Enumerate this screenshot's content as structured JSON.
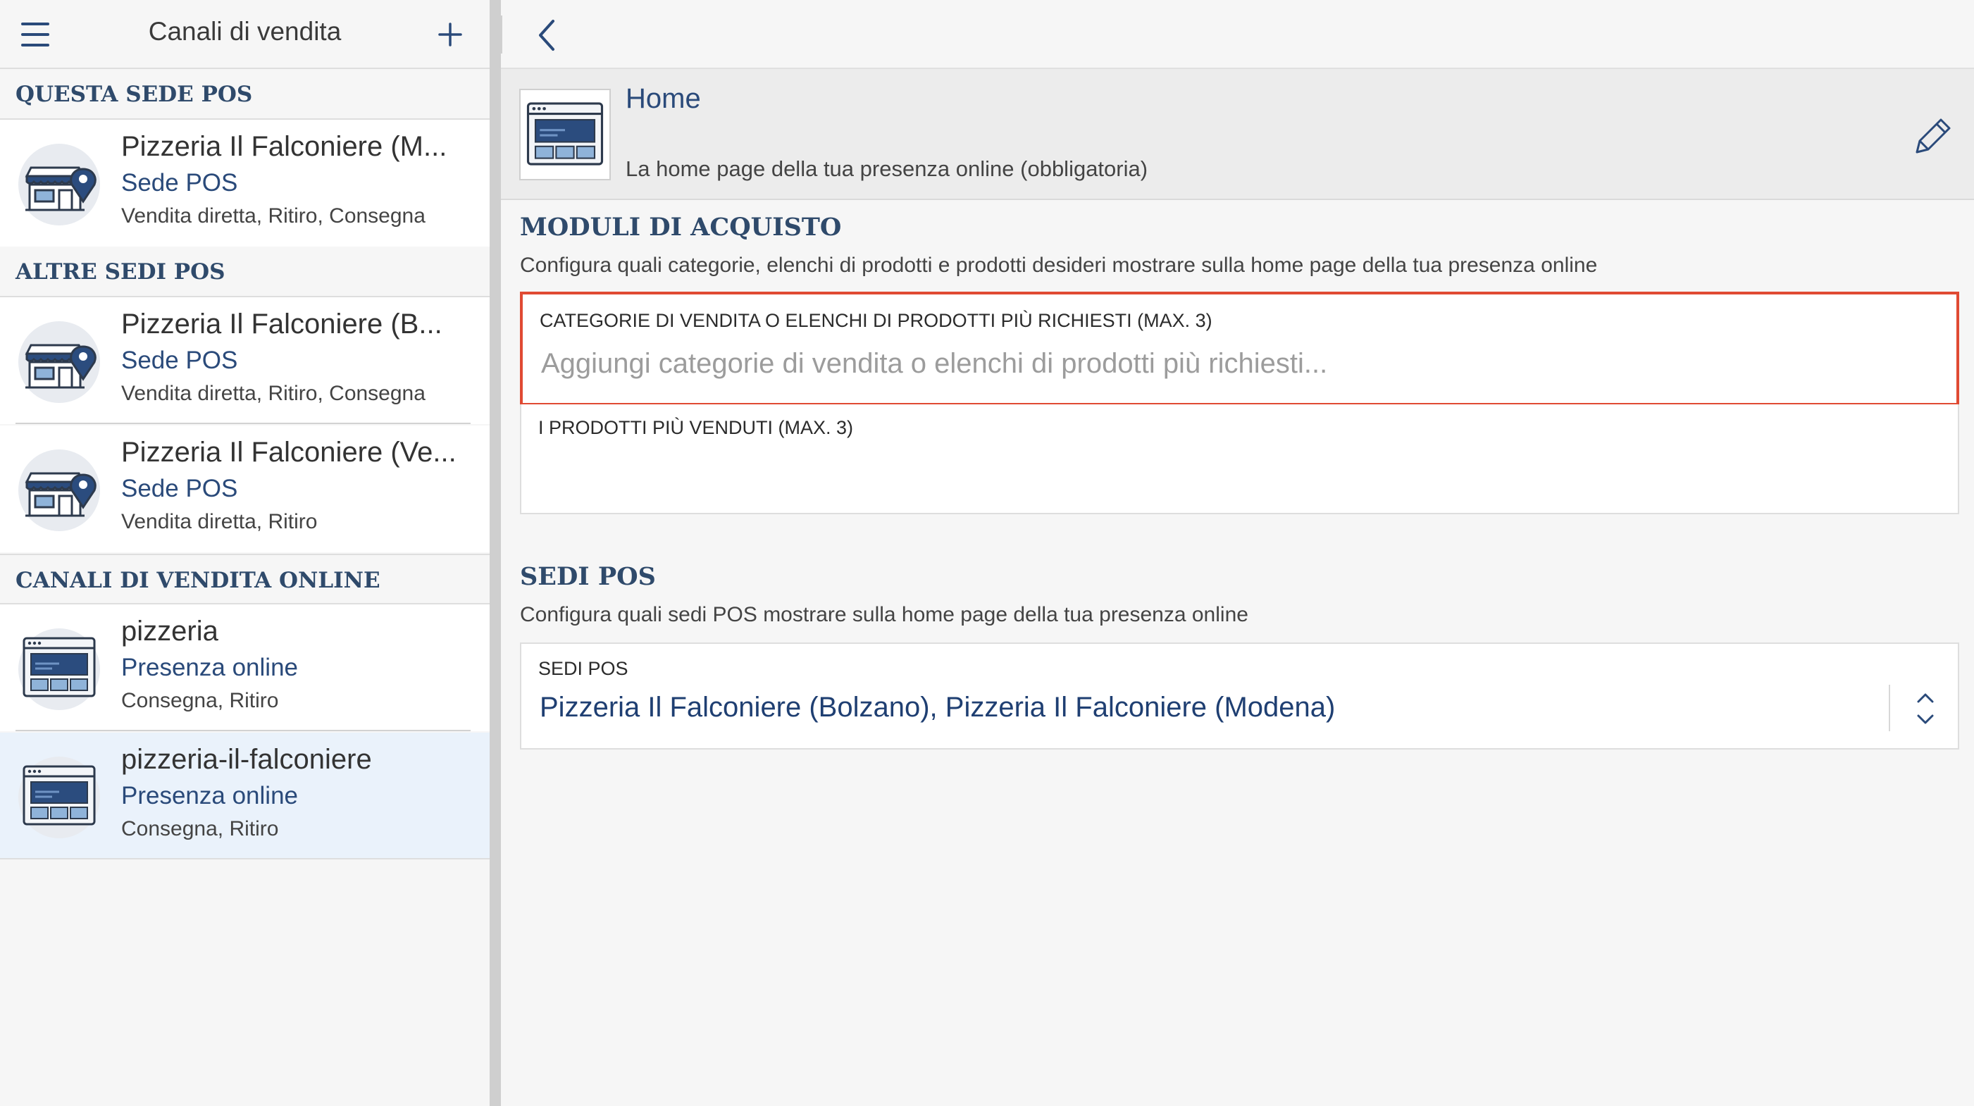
{
  "sidebar": {
    "title": "Canali di vendita",
    "sections": {
      "this_pos": "QUESTA SEDE POS",
      "other_pos": "ALTRE SEDI POS",
      "online": "CANALI DI VENDITA ONLINE"
    },
    "items": [
      {
        "title": "Pizzeria Il Falconiere (M...",
        "type": "Sede POS",
        "desc": "Vendita diretta, Ritiro, Consegna",
        "icon": "store-location-icon"
      },
      {
        "title": "Pizzeria Il Falconiere (B...",
        "type": "Sede POS",
        "desc": "Vendita diretta, Ritiro, Consegna",
        "icon": "store-location-icon"
      },
      {
        "title": "Pizzeria Il Falconiere (Ve...",
        "type": "Sede POS",
        "desc": "Vendita diretta, Ritiro",
        "icon": "store-location-icon"
      },
      {
        "title": "pizzeria",
        "type": "Presenza online",
        "desc": "Consegna, Ritiro",
        "icon": "website-icon"
      },
      {
        "title": "pizzeria-il-falconiere",
        "type": "Presenza online",
        "desc": "Consegna, Ritiro",
        "icon": "website-icon",
        "selected": true
      }
    ]
  },
  "page": {
    "title": "Home",
    "subtitle": "La home page della tua presenza online (obbligatoria)"
  },
  "purchase_modules": {
    "title": "MODULI DI ACQUISTO",
    "description": "Configura quali categorie, elenchi di prodotti e prodotti desideri mostrare sulla home page della tua presenza online",
    "categories_label": "CATEGORIE DI VENDITA O ELENCHI DI PRODOTTI PIÙ RICHIESTI (MAX. 3)",
    "categories_placeholder": "Aggiungi categorie di vendita o elenchi di prodotti più richiesti...",
    "bestsellers_label": "I PRODOTTI PIÙ VENDUTI (MAX. 3)"
  },
  "pos_sites": {
    "title": "SEDI POS",
    "description": "Configura quali sedi POS mostrare sulla home page della tua presenza online",
    "field_label": "SEDI POS",
    "value": "Pizzeria Il Falconiere (Bolzano), Pizzeria Il Falconiere (Modena)"
  },
  "colors": {
    "accent": "#2a4a7a",
    "highlight_border": "#e04a33",
    "selected_row": "#eaf2fb"
  }
}
